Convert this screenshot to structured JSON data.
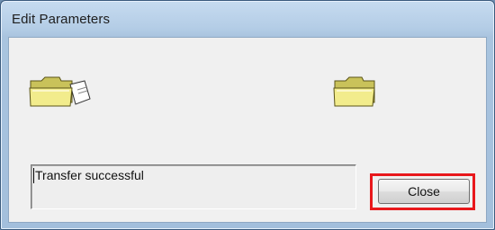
{
  "window": {
    "title": "Edit Parameters"
  },
  "icons": {
    "source": "folder-with-document-icon",
    "destination": "folder-icon"
  },
  "status": {
    "text": "Transfer successful"
  },
  "buttons": {
    "close_label": "Close"
  },
  "colors": {
    "highlight": "#e8181c",
    "folder": "#f2ec8c"
  }
}
